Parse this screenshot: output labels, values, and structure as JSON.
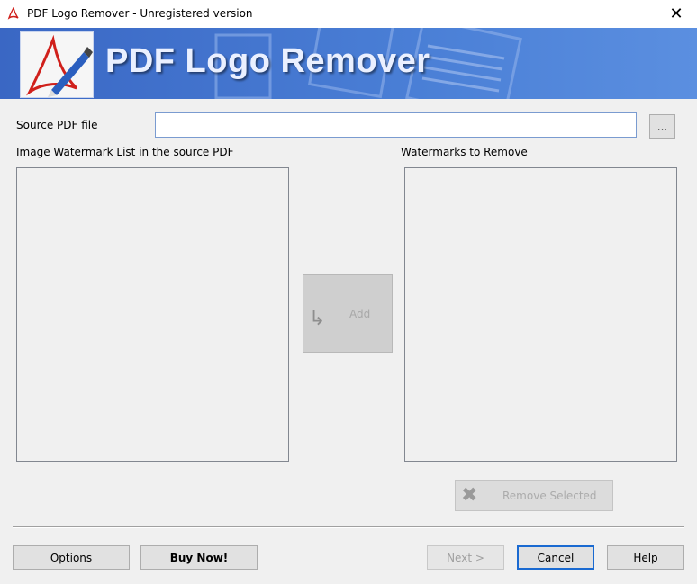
{
  "window": {
    "title": "PDF Logo Remover - Unregistered version",
    "close_glyph": "✕"
  },
  "banner": {
    "title": "PDF Logo Remover",
    "background": "#4a7fd6",
    "logo_icon": "pdf-pen-logo"
  },
  "source": {
    "label": "Source PDF file",
    "value": "",
    "browse_label": "..."
  },
  "lists": {
    "left_label": "Image Watermark List in the source PDF",
    "right_label": "Watermarks to Remove"
  },
  "actions": {
    "add_label": "Add",
    "add_icon": "arrow-right-icon",
    "remove_selected_label": "Remove Selected",
    "remove_icon": "x-icon"
  },
  "footer": {
    "options_label": "Options",
    "buy_now_label": "Buy Now!",
    "next_label": "Next >",
    "cancel_label": "Cancel",
    "help_label": "Help"
  }
}
